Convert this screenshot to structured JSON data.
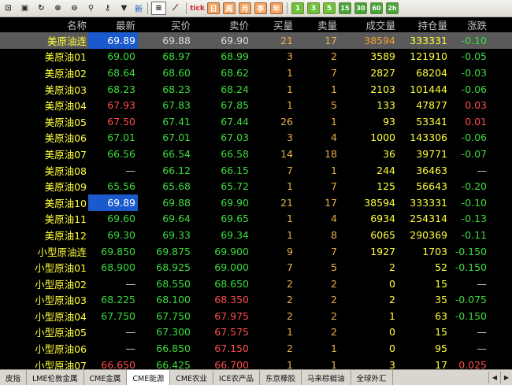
{
  "toolbar": {
    "buttons": [
      {
        "label": "⊡",
        "kind": "plain",
        "name": "grid-icon"
      },
      {
        "label": "▣",
        "kind": "plain",
        "name": "calculator-icon"
      },
      {
        "label": "↻",
        "kind": "plain",
        "name": "refresh-icon"
      },
      {
        "label": "⊕",
        "kind": "plain",
        "name": "zoom-in-icon"
      },
      {
        "label": "⊖",
        "kind": "plain",
        "name": "zoom-out-icon"
      },
      {
        "label": "⚲",
        "kind": "plain",
        "name": "search-icon"
      },
      {
        "label": "⚷",
        "kind": "plain",
        "name": "key-icon"
      },
      {
        "label": "▼",
        "kind": "plain",
        "name": "funnel-icon"
      },
      {
        "label": "新",
        "kind": "txt",
        "name": "new-button"
      },
      {
        "label": "≡",
        "kind": "sel",
        "name": "list-view-icon"
      },
      {
        "label": "⟋",
        "kind": "plain",
        "name": "line-chart-icon"
      },
      {
        "label": "tick",
        "kind": "red",
        "name": "tick-chart-button"
      },
      {
        "label": "日",
        "kind": "sqo",
        "name": "daily-period-button"
      },
      {
        "label": "周",
        "kind": "sqo",
        "name": "weekly-period-button"
      },
      {
        "label": "月",
        "kind": "sqo",
        "name": "monthly-period-button"
      },
      {
        "label": "季",
        "kind": "sqo",
        "name": "quarterly-period-button"
      },
      {
        "label": "年",
        "kind": "sqo",
        "name": "yearly-period-button"
      },
      {
        "label": "1",
        "kind": "sq",
        "name": "1min-period-button"
      },
      {
        "label": "3",
        "kind": "sq",
        "name": "3min-period-button"
      },
      {
        "label": "5",
        "kind": "sq",
        "name": "5min-period-button"
      },
      {
        "label": "15",
        "kind": "sqg",
        "name": "15min-period-button"
      },
      {
        "label": "30",
        "kind": "sqg",
        "name": "30min-period-button"
      },
      {
        "label": "60",
        "kind": "sqg",
        "name": "60min-period-button"
      },
      {
        "label": "2h",
        "kind": "sqg",
        "name": "2hour-period-button"
      }
    ]
  },
  "header": {
    "name": "名称",
    "last": "最新",
    "bid": "买价",
    "ask": "卖价",
    "bid_vol": "买量",
    "ask_vol": "卖量",
    "volume": "成交量",
    "open_interest": "持仓量",
    "change": "涨跌"
  },
  "rows": [
    {
      "name": "美原油连",
      "last": "69.89",
      "bid": "69.88",
      "ask": "69.90",
      "bid_vol": "21",
      "ask_vol": "17",
      "volume": "38594",
      "open_interest": "333331",
      "change": "-0.10",
      "last_dir": "hl",
      "bid_dir": "flat",
      "ask_dir": "flat",
      "chg_dir": "dn",
      "selected": true
    },
    {
      "name": "美原油01",
      "last": "69.00",
      "bid": "68.97",
      "ask": "68.99",
      "bid_vol": "3",
      "ask_vol": "2",
      "volume": "3589",
      "open_interest": "121910",
      "change": "-0.05",
      "last_dir": "dn",
      "bid_dir": "dn",
      "ask_dir": "dn",
      "chg_dir": "dn"
    },
    {
      "name": "美原油02",
      "last": "68.64",
      "bid": "68.60",
      "ask": "68.62",
      "bid_vol": "1",
      "ask_vol": "7",
      "volume": "2827",
      "open_interest": "68204",
      "change": "-0.03",
      "last_dir": "dn",
      "bid_dir": "dn",
      "ask_dir": "dn",
      "chg_dir": "dn"
    },
    {
      "name": "美原油03",
      "last": "68.23",
      "bid": "68.23",
      "ask": "68.24",
      "bid_vol": "1",
      "ask_vol": "1",
      "volume": "2103",
      "open_interest": "101444",
      "change": "-0.06",
      "last_dir": "dn",
      "bid_dir": "dn",
      "ask_dir": "dn",
      "chg_dir": "dn"
    },
    {
      "name": "美原油04",
      "last": "67.93",
      "bid": "67.83",
      "ask": "67.85",
      "bid_vol": "1",
      "ask_vol": "5",
      "volume": "133",
      "open_interest": "47877",
      "change": "0.03",
      "last_dir": "up",
      "bid_dir": "dn",
      "ask_dir": "dn",
      "chg_dir": "up"
    },
    {
      "name": "美原油05",
      "last": "67.50",
      "bid": "67.41",
      "ask": "67.44",
      "bid_vol": "26",
      "ask_vol": "1",
      "volume": "93",
      "open_interest": "53341",
      "change": "0.01",
      "last_dir": "up",
      "bid_dir": "dn",
      "ask_dir": "dn",
      "chg_dir": "up"
    },
    {
      "name": "美原油06",
      "last": "67.01",
      "bid": "67.01",
      "ask": "67.03",
      "bid_vol": "3",
      "ask_vol": "4",
      "volume": "1000",
      "open_interest": "143306",
      "change": "-0.06",
      "last_dir": "dn",
      "bid_dir": "dn",
      "ask_dir": "dn",
      "chg_dir": "dn"
    },
    {
      "name": "美原油07",
      "last": "66.56",
      "bid": "66.54",
      "ask": "66.58",
      "bid_vol": "14",
      "ask_vol": "18",
      "volume": "36",
      "open_interest": "39771",
      "change": "-0.07",
      "last_dir": "dn",
      "bid_dir": "dn",
      "ask_dir": "dn",
      "chg_dir": "dn"
    },
    {
      "name": "美原油08",
      "last": "—",
      "bid": "66.12",
      "ask": "66.15",
      "bid_vol": "7",
      "ask_vol": "1",
      "volume": "244",
      "open_interest": "36463",
      "change": "—",
      "last_dir": "flat",
      "bid_dir": "dn",
      "ask_dir": "dn",
      "chg_dir": "flat"
    },
    {
      "name": "美原油09",
      "last": "65.56",
      "bid": "65.68",
      "ask": "65.72",
      "bid_vol": "1",
      "ask_vol": "7",
      "volume": "125",
      "open_interest": "56643",
      "change": "-0.20",
      "last_dir": "dn",
      "bid_dir": "dn",
      "ask_dir": "dn",
      "chg_dir": "dn"
    },
    {
      "name": "美原油10",
      "last": "69.89",
      "bid": "69.88",
      "ask": "69.90",
      "bid_vol": "21",
      "ask_vol": "17",
      "volume": "38594",
      "open_interest": "333331",
      "change": "-0.10",
      "last_dir": "hl",
      "bid_dir": "dn",
      "ask_dir": "dn",
      "chg_dir": "dn"
    },
    {
      "name": "美原油11",
      "last": "69.60",
      "bid": "69.64",
      "ask": "69.65",
      "bid_vol": "1",
      "ask_vol": "4",
      "volume": "6934",
      "open_interest": "254314",
      "change": "-0.13",
      "last_dir": "dn",
      "bid_dir": "dn",
      "ask_dir": "dn",
      "chg_dir": "dn"
    },
    {
      "name": "美原油12",
      "last": "69.30",
      "bid": "69.33",
      "ask": "69.34",
      "bid_vol": "1",
      "ask_vol": "8",
      "volume": "6065",
      "open_interest": "290369",
      "change": "-0.11",
      "last_dir": "dn",
      "bid_dir": "dn",
      "ask_dir": "dn",
      "chg_dir": "dn"
    },
    {
      "name": "小型原油连",
      "last": "69.850",
      "bid": "69.875",
      "ask": "69.900",
      "bid_vol": "9",
      "ask_vol": "7",
      "volume": "1927",
      "open_interest": "1703",
      "change": "-0.150",
      "last_dir": "dn",
      "bid_dir": "dn",
      "ask_dir": "dn",
      "chg_dir": "dn"
    },
    {
      "name": "小型原油01",
      "last": "68.900",
      "bid": "68.925",
      "ask": "69.000",
      "bid_vol": "7",
      "ask_vol": "5",
      "volume": "2",
      "open_interest": "52",
      "change": "-0.150",
      "last_dir": "dn",
      "bid_dir": "dn",
      "ask_dir": "dn",
      "chg_dir": "dn"
    },
    {
      "name": "小型原油02",
      "last": "—",
      "bid": "68.550",
      "ask": "68.650",
      "bid_vol": "2",
      "ask_vol": "2",
      "volume": "0",
      "open_interest": "15",
      "change": "—",
      "last_dir": "flat",
      "bid_dir": "dn",
      "ask_dir": "dn",
      "chg_dir": "flat"
    },
    {
      "name": "小型原油03",
      "last": "68.225",
      "bid": "68.100",
      "ask": "68.350",
      "bid_vol": "2",
      "ask_vol": "2",
      "volume": "2",
      "open_interest": "35",
      "change": "-0.075",
      "last_dir": "dn",
      "bid_dir": "dn",
      "ask_dir": "up",
      "chg_dir": "dn"
    },
    {
      "name": "小型原油04",
      "last": "67.750",
      "bid": "67.750",
      "ask": "67.975",
      "bid_vol": "2",
      "ask_vol": "2",
      "volume": "1",
      "open_interest": "63",
      "change": "-0.150",
      "last_dir": "dn",
      "bid_dir": "dn",
      "ask_dir": "up",
      "chg_dir": "dn"
    },
    {
      "name": "小型原油05",
      "last": "—",
      "bid": "67.300",
      "ask": "67.575",
      "bid_vol": "1",
      "ask_vol": "2",
      "volume": "0",
      "open_interest": "15",
      "change": "—",
      "last_dir": "flat",
      "bid_dir": "dn",
      "ask_dir": "up",
      "chg_dir": "flat"
    },
    {
      "name": "小型原油06",
      "last": "—",
      "bid": "66.850",
      "ask": "67.150",
      "bid_vol": "2",
      "ask_vol": "1",
      "volume": "0",
      "open_interest": "95",
      "change": "—",
      "last_dir": "flat",
      "bid_dir": "dn",
      "ask_dir": "up",
      "chg_dir": "flat"
    },
    {
      "name": "小型原油07",
      "last": "66.650",
      "bid": "66.425",
      "ask": "66.700",
      "bid_vol": "1",
      "ask_vol": "1",
      "volume": "3",
      "open_interest": "17",
      "change": "0.025",
      "last_dir": "up",
      "bid_dir": "dn",
      "ask_dir": "up",
      "chg_dir": "up"
    }
  ],
  "tabs": [
    {
      "label": "皮指",
      "active": false
    },
    {
      "label": "LME伦敦金属",
      "active": false
    },
    {
      "label": "CME金属",
      "active": false
    },
    {
      "label": "CME能源",
      "active": true
    },
    {
      "label": "CME农业",
      "active": false
    },
    {
      "label": "ICE农产品",
      "active": false
    },
    {
      "label": "东京橡胶",
      "active": false
    },
    {
      "label": "马来棕榈油",
      "active": false
    },
    {
      "label": "全球外汇",
      "active": false
    }
  ],
  "scroll": {
    "left": "◀",
    "right": "▶"
  }
}
